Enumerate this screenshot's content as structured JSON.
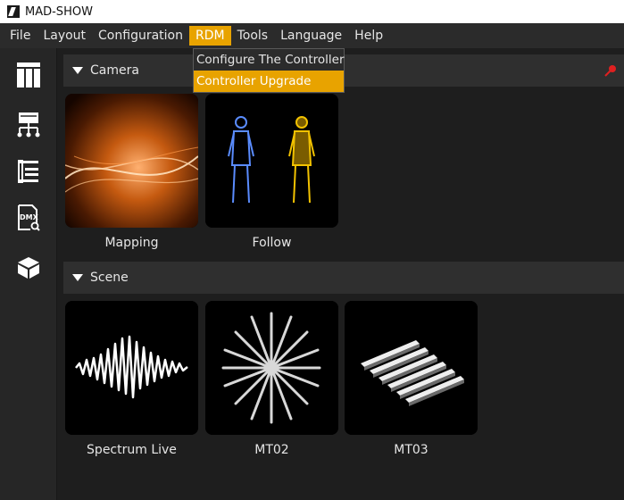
{
  "window": {
    "title": "MAD-SHOW"
  },
  "menu": {
    "items": [
      {
        "label": "File"
      },
      {
        "label": "Layout"
      },
      {
        "label": "Configuration"
      },
      {
        "label": "RDM"
      },
      {
        "label": "Tools"
      },
      {
        "label": "Language"
      },
      {
        "label": "Help"
      }
    ]
  },
  "rdm_menu": {
    "items": [
      {
        "label": "Configure The Controller"
      },
      {
        "label": "Controller Upgrade"
      }
    ]
  },
  "sections": [
    {
      "title": "Camera",
      "tiles": [
        {
          "label": "Mapping"
        },
        {
          "label": "Follow"
        }
      ]
    },
    {
      "title": "Scene",
      "tiles": [
        {
          "label": "Spectrum Live"
        },
        {
          "label": "MT02"
        },
        {
          "label": "MT03"
        }
      ]
    }
  ],
  "sidebar": {
    "icons": [
      "layout-grid-icon",
      "network-icon",
      "list-icon",
      "dmx-file-icon",
      "cube-icon"
    ],
    "dmx_icon_text": "DMX"
  },
  "colors": {
    "accent": "#e8a300",
    "pin": "#e02020"
  }
}
